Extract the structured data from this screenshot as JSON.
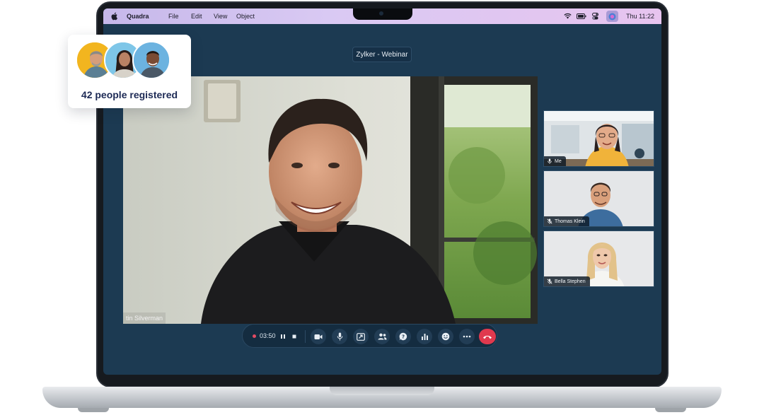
{
  "menubar": {
    "app_name": "Quadra",
    "items": [
      "File",
      "Edit",
      "View",
      "Object"
    ],
    "clock": "Thu 11:22"
  },
  "webinar": {
    "title": "Zylker - Webinar",
    "speaker_name": "tin Silverman"
  },
  "participants": [
    {
      "label": "Me"
    },
    {
      "label": "Thomas Klein"
    },
    {
      "label": "Bella Stephen"
    }
  ],
  "controls": {
    "timer": "03:50",
    "buttons": [
      "pause-icon",
      "stop-icon",
      "video-icon",
      "mic-icon",
      "share-screen-icon",
      "participants-icon",
      "qa-icon",
      "poll-icon",
      "reactions-icon",
      "more-icon",
      "end-call-icon"
    ],
    "end_color": "#e0394e"
  },
  "registration": {
    "text": "42 people registered",
    "avatar_colors": [
      "#f2b51f",
      "#7ec6e8",
      "#6cb3e0"
    ]
  }
}
